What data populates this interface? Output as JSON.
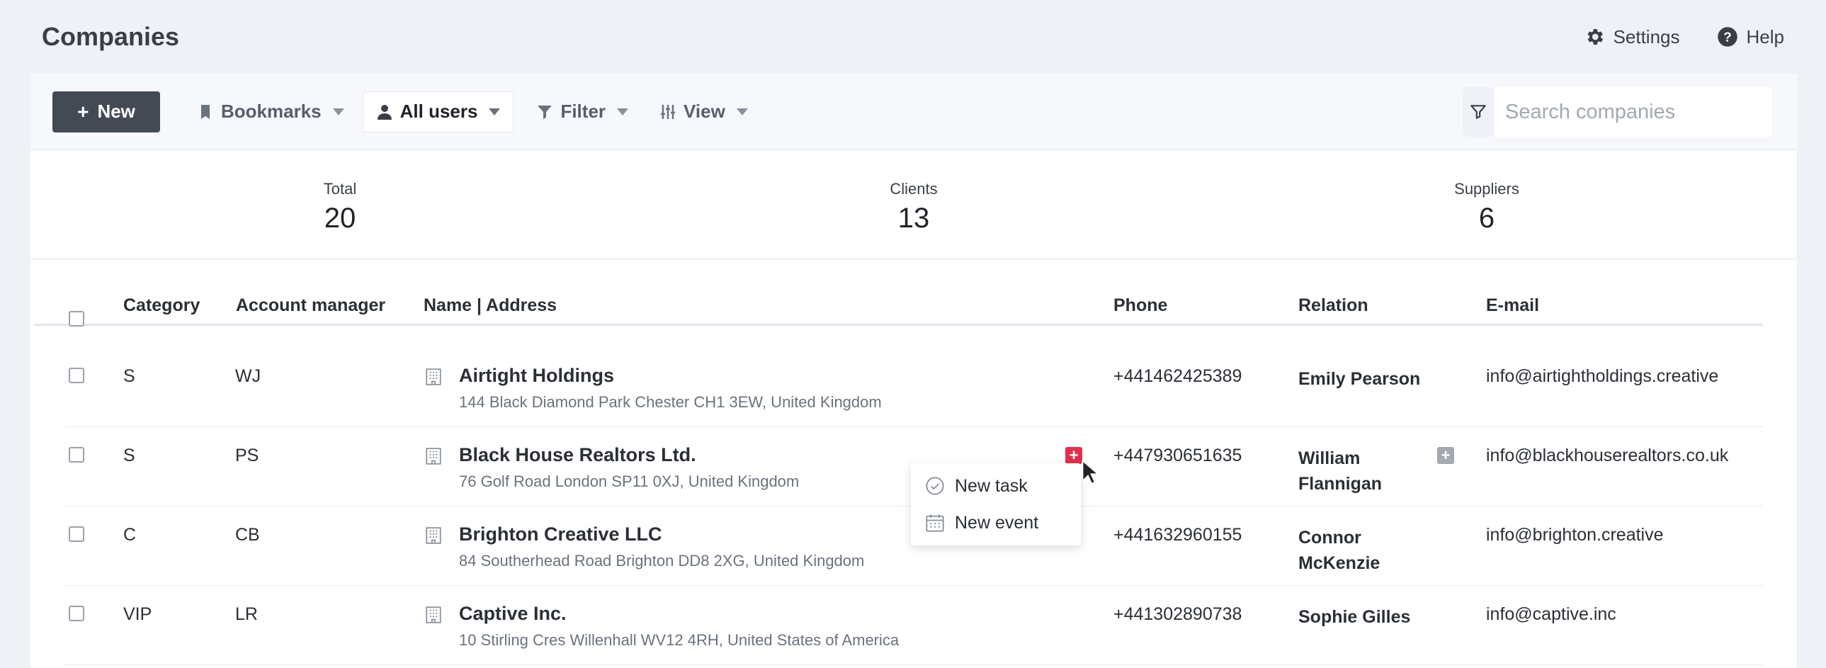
{
  "header": {
    "title": "Companies",
    "settings_label": "Settings",
    "help_label": "Help"
  },
  "toolbar": {
    "new_label": "New",
    "bookmarks_label": "Bookmarks",
    "users_label": "All users",
    "filter_label": "Filter",
    "view_label": "View",
    "search_placeholder": "Search companies"
  },
  "stats": [
    {
      "label": "Total",
      "value": "20"
    },
    {
      "label": "Clients",
      "value": "13"
    },
    {
      "label": "Suppliers",
      "value": "6"
    }
  ],
  "table": {
    "columns": {
      "category": "Category",
      "manager": "Account manager",
      "name": "Name | Address",
      "phone": "Phone",
      "relation": "Relation",
      "email": "E-mail"
    },
    "rows": [
      {
        "category": "S",
        "manager": "WJ",
        "name": "Airtight Holdings",
        "address": "144 Black Diamond Park Chester CH1 3EW, United Kingdom",
        "phone": "+441462425389",
        "relation": "Emily Pearson",
        "email": "info@airtightholdings.creative"
      },
      {
        "category": "S",
        "manager": "PS",
        "name": "Black House Realtors Ltd.",
        "address": "76 Golf Road London SP11 0XJ, United Kingdom",
        "phone": "+447930651635",
        "relation": "William Flannigan",
        "email": "info@blackhouserealtors.co.uk"
      },
      {
        "category": "C",
        "manager": "CB",
        "name": "Brighton Creative LLC",
        "address": "84 Southerhead Road Brighton DD8 2XG, United Kingdom",
        "phone": "+441632960155",
        "relation": "Connor McKenzie",
        "email": "info@brighton.creative"
      },
      {
        "category": "VIP",
        "manager": "LR",
        "name": "Captive Inc.",
        "address": "10 Stirling Cres Willenhall WV12 4RH, United States of America",
        "phone": "+441302890738",
        "relation": "Sophie Gilles",
        "email": "info@captive.inc"
      }
    ]
  },
  "context_menu": {
    "new_task_label": "New task",
    "new_event_label": "New event"
  },
  "colors": {
    "accent_red": "#e2304c",
    "button_dark": "#434a54",
    "add_gray": "#a3a9b2"
  }
}
